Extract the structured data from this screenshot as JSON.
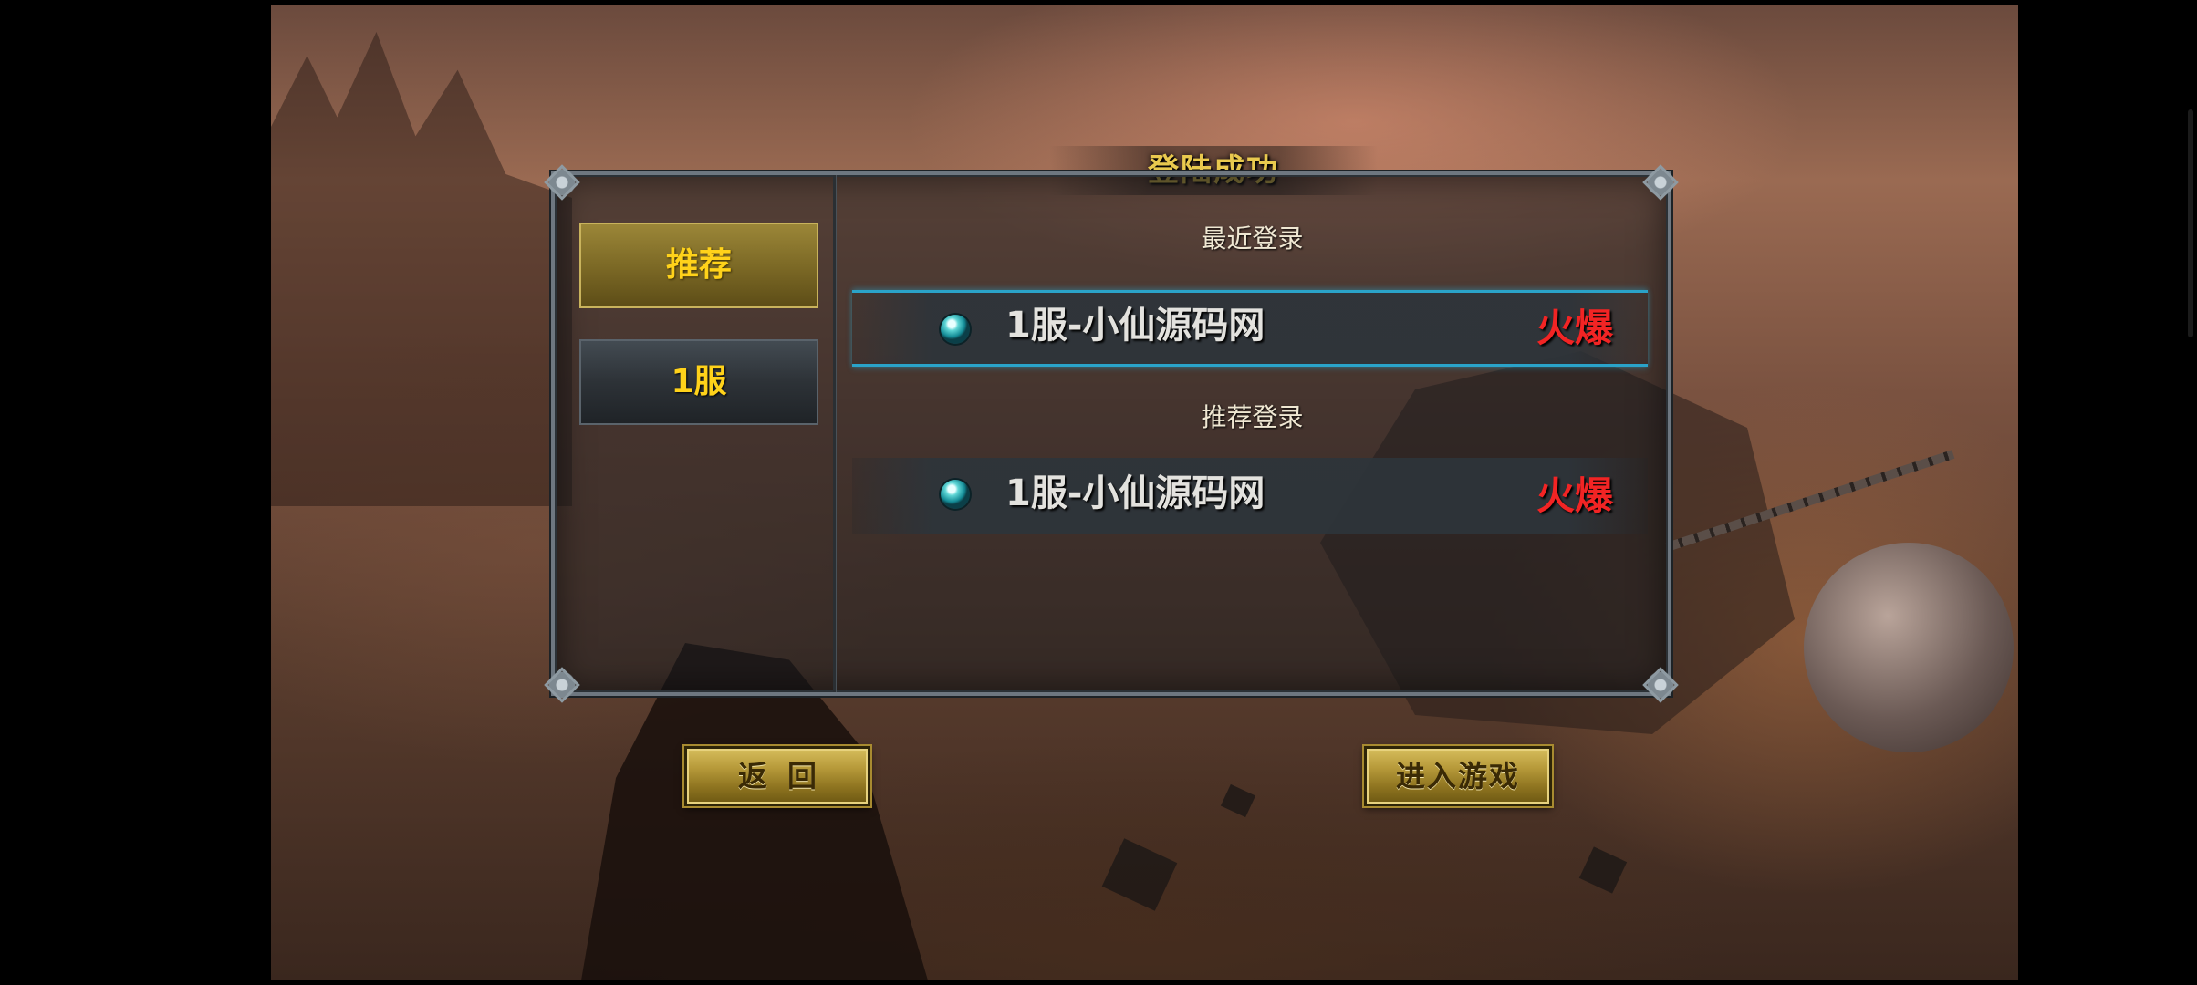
{
  "dialog": {
    "title": "登陆成功"
  },
  "tabs": [
    {
      "label": "推荐",
      "active": true
    },
    {
      "label": "1服",
      "active": false
    }
  ],
  "sections": {
    "recent_label": "最近登录",
    "recommended_label": "推荐登录"
  },
  "servers": {
    "recent": {
      "name": "1服-小仙源码网",
      "status": "火爆",
      "selected": true
    },
    "recommended": {
      "name": "1服-小仙源码网",
      "status": "火爆",
      "selected": false
    }
  },
  "buttons": {
    "back": "返回",
    "enter": "进入游戏"
  },
  "colors": {
    "title_gold": "#e9c94e",
    "tab_text": "#ffd21a",
    "status_hot": "#f22424",
    "row_highlight": "#2aa3c9"
  },
  "icons": {
    "server_indicator": "teal-orb-icon",
    "panel_corners": "ornament-corner-icon"
  }
}
